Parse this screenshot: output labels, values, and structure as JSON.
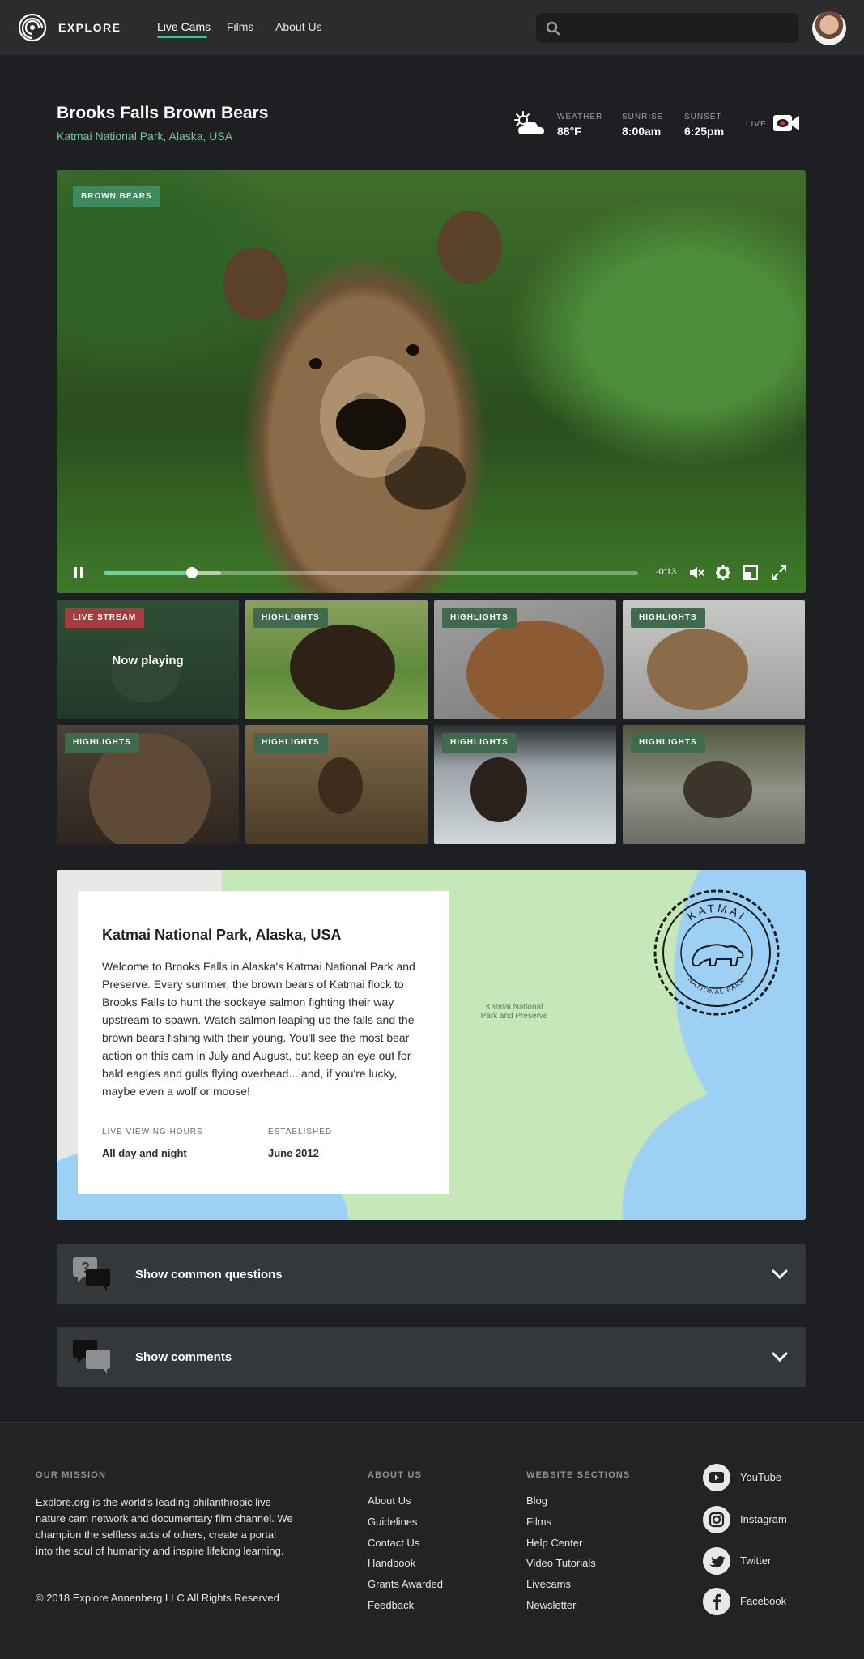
{
  "header": {
    "logo_text": "EXPLORE",
    "nav": [
      "Live Cams",
      "Films",
      "About Us"
    ],
    "active_nav": "Live Cams",
    "search_placeholder": ""
  },
  "cam": {
    "title": "Brooks Falls Brown Bears",
    "location": "Katmai National Park, Alaska, USA",
    "weather_label": "WEATHER",
    "weather_value": "88°F",
    "sunrise_label": "SUNRISE",
    "sunrise_value": "8:00am",
    "sunset_label": "SUNSET",
    "sunset_value": "6:25pm",
    "live_label": "LIVE"
  },
  "video": {
    "tag": "BROWN BEARS",
    "time_remaining": "-0:13",
    "progress": 0.165,
    "buffered": 0.22
  },
  "thumbnails": [
    {
      "tag": "LIVE STREAM",
      "overlay": "Now playing"
    },
    {
      "tag": "HIGHLIGHTS"
    },
    {
      "tag": "HIGHLIGHTS"
    },
    {
      "tag": "HIGHLIGHTS"
    },
    {
      "tag": "HIGHLIGHTS"
    },
    {
      "tag": "HIGHLIGHTS"
    },
    {
      "tag": "HIGHLIGHTS"
    },
    {
      "tag": "HIGHLIGHTS"
    }
  ],
  "info": {
    "title": "Katmai National Park, Alaska, USA",
    "description": "Welcome to Brooks Falls in Alaska's Katmai National Park and Preserve. Every summer, the brown bears of Katmai flock to Brooks Falls to hunt the sockeye salmon fighting their way upstream to spawn. Watch salmon leaping up the falls and the brown bears fishing with their young. You'll see the most bear action on this cam in July and August, but keep an eye out for bald eagles and gulls flying overhead... and, if you're lucky, maybe even a wolf or moose!",
    "hours_label": "LIVE VIEWING HOURS",
    "hours_value": "All day and night",
    "established_label": "ESTABLISHED",
    "established_value": "June 2012",
    "map_label": "Katmai National Park and Preserve",
    "seal_top": "KATMAI",
    "seal_bottom": "NATIONAL PARK"
  },
  "accordions": {
    "questions": "Show common questions",
    "comments": "Show comments"
  },
  "footer": {
    "mission_heading": "OUR MISSION",
    "mission_text": "Explore.org is the world's leading philanthropic live nature cam network and documentary film channel. We champion the selfless acts of others, create a portal into the soul of humanity and inspire lifelong learning.",
    "copyright": "© 2018 Explore Annenberg LLC   All Rights Reserved",
    "about_heading": "ABOUT US",
    "about_links": [
      "About Us",
      "Guidelines",
      "Contact Us",
      "Handbook",
      "Grants Awarded",
      "Feedback"
    ],
    "sections_heading": "WEBSITE SECTIONS",
    "section_links": [
      "Blog",
      "Films",
      "Help Center",
      "Video Tutorials",
      "Livecams",
      "Newsletter"
    ],
    "social": [
      "YouTube",
      "Instagram",
      "Twitter",
      "Facebook"
    ]
  },
  "colors": {
    "accent": "#55b887",
    "live": "#a83c3c",
    "background": "#1e1f22"
  }
}
